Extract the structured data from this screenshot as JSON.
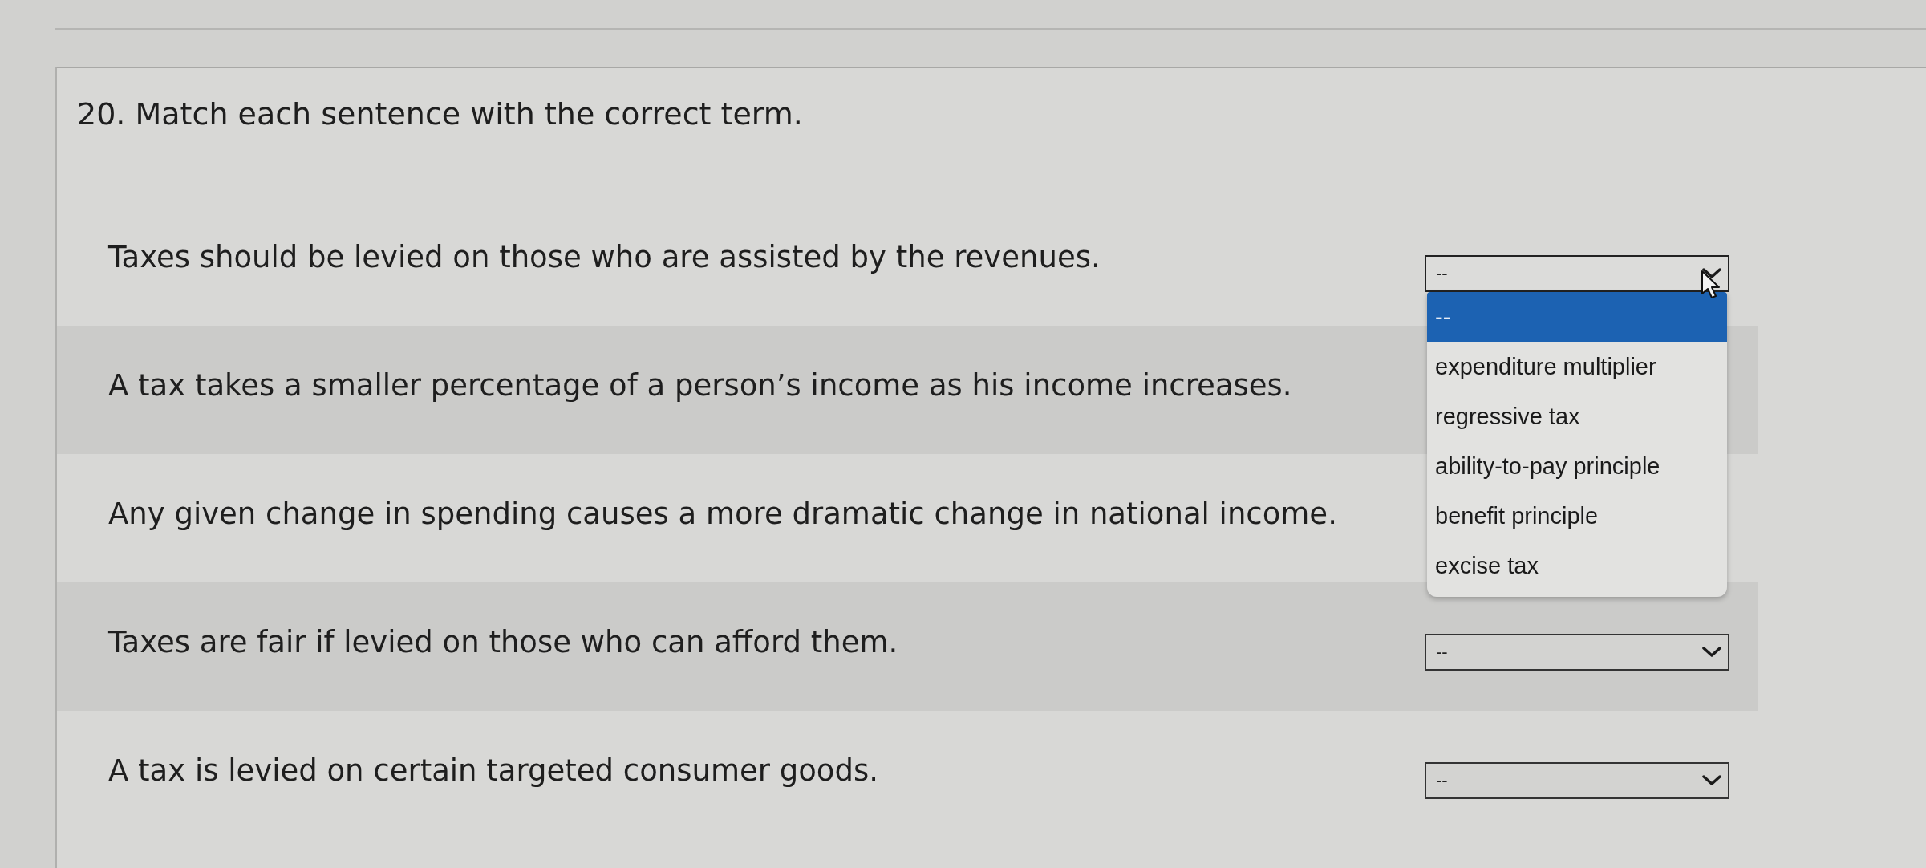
{
  "question": {
    "title": "20. Match each sentence with the correct term."
  },
  "rows": [
    {
      "sentence": "Taxes should be levied on those who are assisted by the revenues.",
      "answer": {
        "value": "--",
        "expanded": true,
        "options": [
          {
            "label": "--",
            "selected": true
          },
          {
            "label": "expenditure multiplier",
            "selected": false
          },
          {
            "label": "regressive tax",
            "selected": false
          },
          {
            "label": "ability-to-pay principle",
            "selected": false
          },
          {
            "label": "benefit principle",
            "selected": false
          },
          {
            "label": "excise tax",
            "selected": false
          }
        ]
      }
    },
    {
      "sentence": "A tax takes a smaller percentage of a person’s income as his income increases."
    },
    {
      "sentence": "Any given change in spending causes a more dramatic change in national income."
    },
    {
      "sentence": "Taxes are fair if levied on those who can afford them.",
      "answer": {
        "value": "--",
        "expanded": false
      }
    },
    {
      "sentence": "A tax is levied on certain targeted consumer goods.",
      "answer": {
        "value": "--",
        "expanded": false
      }
    }
  ]
}
